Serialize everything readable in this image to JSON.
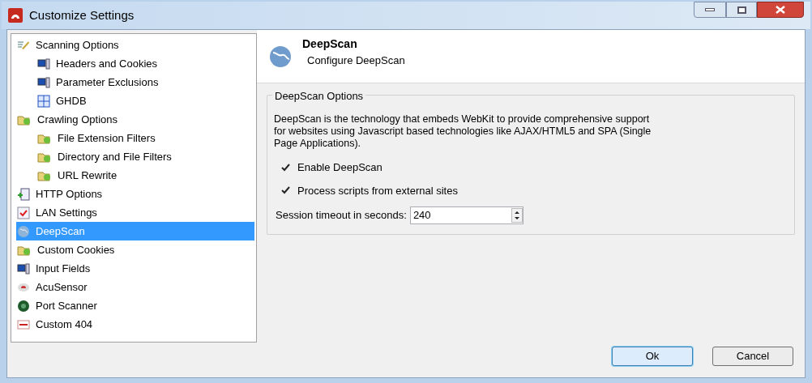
{
  "window": {
    "title": "Customize Settings"
  },
  "tree": [
    {
      "label": "Scanning Options",
      "selected": false,
      "children": [
        {
          "label": "Headers and Cookies",
          "selected": false
        },
        {
          "label": "Parameter Exclusions",
          "selected": false
        },
        {
          "label": "GHDB",
          "selected": false
        }
      ]
    },
    {
      "label": "Crawling Options",
      "selected": false,
      "children": [
        {
          "label": "File Extension Filters",
          "selected": false
        },
        {
          "label": "Directory and File Filters",
          "selected": false
        },
        {
          "label": "URL Rewrite",
          "selected": false
        }
      ]
    },
    {
      "label": "HTTP Options",
      "selected": false
    },
    {
      "label": "LAN Settings",
      "selected": false
    },
    {
      "label": "DeepScan",
      "selected": true
    },
    {
      "label": "Custom Cookies",
      "selected": false
    },
    {
      "label": "Input Fields",
      "selected": false
    },
    {
      "label": "AcuSensor",
      "selected": false
    },
    {
      "label": "Port Scanner",
      "selected": false
    },
    {
      "label": "Custom 404",
      "selected": false
    }
  ],
  "header": {
    "title": "DeepScan",
    "subtitle": "Configure DeepScan"
  },
  "group": {
    "title": "DeepScan Options",
    "description": "DeepScan is the technology that embeds WebKit to provide comprehensive support for websites using Javascript based technologies like AJAX/HTML5 and SPA (Single Page Applications).",
    "checkboxes": [
      {
        "label": "Enable DeepScan",
        "checked": true
      },
      {
        "label": "Process scripts from external sites",
        "checked": true
      }
    ],
    "timeout": {
      "label": "Session timeout in seconds:",
      "value": "240"
    }
  },
  "buttons": [
    {
      "label": "Ok",
      "default": true
    },
    {
      "label": "Cancel",
      "default": false
    }
  ]
}
